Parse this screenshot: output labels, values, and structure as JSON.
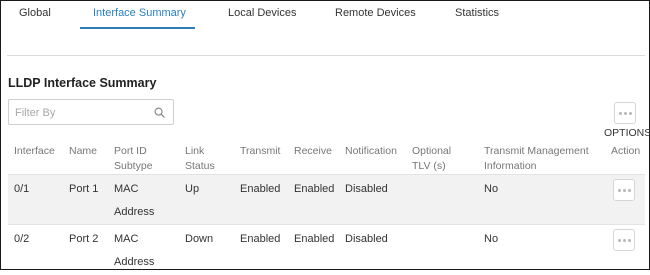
{
  "tabs": [
    {
      "label": "Global",
      "active": false
    },
    {
      "label": "Interface Summary",
      "active": true
    },
    {
      "label": "Local Devices",
      "active": false
    },
    {
      "label": "Remote Devices",
      "active": false
    },
    {
      "label": "Statistics",
      "active": false
    }
  ],
  "section": {
    "title": "LLDP Interface Summary",
    "filter_placeholder": "Filter By",
    "options_label": "OPTIONS"
  },
  "table": {
    "columns": [
      {
        "line1": "Interface",
        "line2": ""
      },
      {
        "line1": "Name",
        "line2": ""
      },
      {
        "line1": "Port ID",
        "line2": "Subtype"
      },
      {
        "line1": "Link",
        "line2": "Status"
      },
      {
        "line1": "Transmit",
        "line2": ""
      },
      {
        "line1": "Receive",
        "line2": ""
      },
      {
        "line1": "Notification",
        "line2": ""
      },
      {
        "line1": "Optional",
        "line2": "TLV (s)"
      },
      {
        "line1": "Transmit Management",
        "line2": "Information"
      },
      {
        "line1": "Action",
        "line2": ""
      }
    ],
    "rows": [
      {
        "interface": "0/1",
        "name": "Port 1",
        "subtype_line1": "MAC",
        "subtype_line2": "Address",
        "link_status": "Up",
        "transmit": "Enabled",
        "receive": "Enabled",
        "notification": "Disabled",
        "optional_tlvs": "",
        "transmit_mgmt": "No"
      },
      {
        "interface": "0/2",
        "name": "Port 2",
        "subtype_line1": "MAC",
        "subtype_line2": "Address",
        "link_status": "Down",
        "transmit": "Enabled",
        "receive": "Enabled",
        "notification": "Disabled",
        "optional_tlvs": "",
        "transmit_mgmt": "No"
      }
    ]
  },
  "colors": {
    "accent": "#2b7fb8",
    "row_shade": "#f2f2f2"
  }
}
